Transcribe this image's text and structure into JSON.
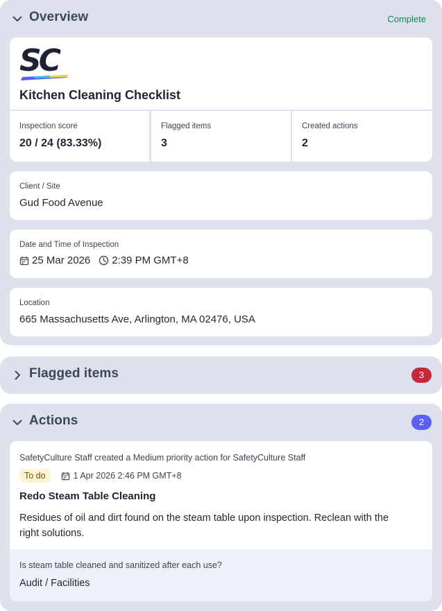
{
  "overview": {
    "title": "Overview",
    "status": "Complete",
    "logo_text": "SC",
    "checklist_title": "Kitchen Cleaning Checklist",
    "stats": [
      {
        "label": "Inspection score",
        "value": "20 / 24 (83.33%)"
      },
      {
        "label": "Flagged items",
        "value": "3"
      },
      {
        "label": "Created actions",
        "value": "2"
      }
    ],
    "client": {
      "label": "Client / Site",
      "value": "Gud Food Avenue"
    },
    "datetime": {
      "label": "Date and Time of Inspection",
      "date": "25 Mar 2026",
      "time": "2:39 PM GMT+8"
    },
    "location": {
      "label": "Location",
      "value": "665 Massachusetts Ave, Arlington, MA 02476, USA"
    }
  },
  "flagged": {
    "title": "Flagged items",
    "count": "3"
  },
  "actions": {
    "title": "Actions",
    "count": "2",
    "items": [
      {
        "meta": "SafetyCulture Staff created a Medium priority action for SafetyCulture Staff",
        "status": "To do",
        "due": "1 Apr 2026 2:46 PM GMT+8",
        "title": "Redo Steam Table Cleaning",
        "description_line1": "Residues of oil and dirt found on the steam table upon inspection. Reclean with the",
        "description_line2": "right solutions.",
        "question": "Is steam table cleaned and sanitized after each use?",
        "category": "Audit / Facilities"
      }
    ]
  },
  "colors": {
    "section_bg": "#dde1ec",
    "status_complete": "#13855b",
    "flagged_badge": "#c6283a",
    "actions_badge": "#5b5ff5",
    "todo_bg": "#fff4d6",
    "question_bg": "#eef1f9"
  },
  "icons": [
    "chevron-down-icon",
    "chevron-right-icon",
    "calendar-icon",
    "clock-icon"
  ]
}
